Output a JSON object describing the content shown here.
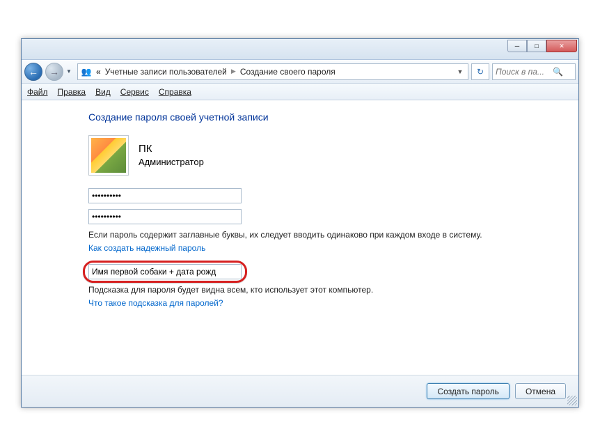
{
  "titlebar": {
    "min_title": "Свернуть",
    "max_title": "Развернуть",
    "close_title": "Закрыть"
  },
  "nav": {
    "back_title": "Назад",
    "fwd_title": "Вперёд"
  },
  "breadcrumb": {
    "prefix": "«",
    "item1": "Учетные записи пользователей",
    "item2": "Создание своего пароля"
  },
  "search": {
    "placeholder": "Поиск в па...",
    "icon_title": "Поиск"
  },
  "menu": {
    "file": "Файл",
    "edit": "Правка",
    "view": "Вид",
    "tools": "Сервис",
    "help": "Справка"
  },
  "page": {
    "heading": "Создание пароля своей учетной записи",
    "username": "ПК",
    "role": "Администратор",
    "pw1": "••••••••••",
    "pw2": "••••••••••",
    "caps_note": "Если пароль содержит заглавные буквы, их следует вводить одинаково при каждом входе в систему.",
    "link_strong": "Как создать надежный пароль",
    "hint_value": "Имя первой собаки + дата рожд",
    "hint_note": "Подсказка для пароля будет видна всем, кто использует этот компьютер.",
    "link_hint": "Что такое подсказка для паролей?"
  },
  "buttons": {
    "create": "Создать пароль",
    "cancel": "Отмена"
  }
}
